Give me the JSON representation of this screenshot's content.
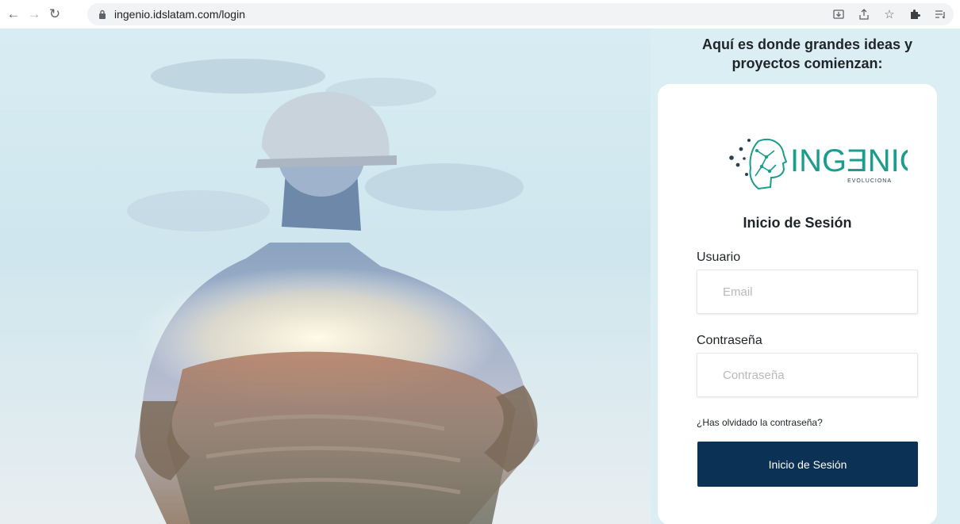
{
  "browser": {
    "url": "ingenio.idslatam.com/login",
    "icons": [
      "back-icon",
      "forward-icon",
      "reload-icon",
      "lock-icon",
      "install-icon",
      "share-icon",
      "star-icon",
      "extensions-icon",
      "reading-list-icon"
    ]
  },
  "page": {
    "tagline": "Aquí es donde grandes ideas y proyectos comienzan:",
    "logo": {
      "name": "INGENIO",
      "name_display": "INGƎNIO",
      "slogan": "EVOLUCIONA"
    },
    "login": {
      "title": "Inicio de Sesión",
      "user_label": "Usuario",
      "user_placeholder": "Email",
      "password_label": "Contraseña",
      "password_placeholder": "Contraseña",
      "forgot": "¿Has olvidado la contraseña?",
      "submit": "Inicio de Sesión"
    }
  },
  "colors": {
    "background": "#dbeef4",
    "button": "#0b3154",
    "logo": "#1b9c8c"
  }
}
